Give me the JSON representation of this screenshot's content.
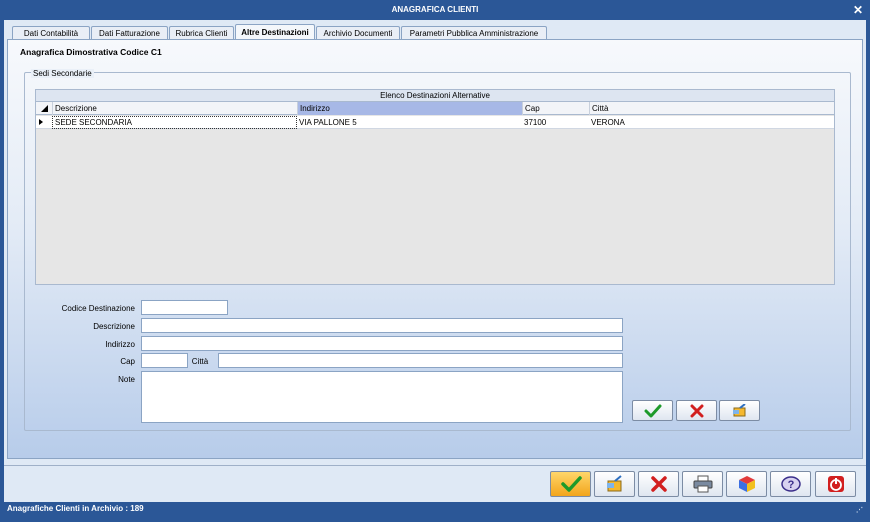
{
  "window": {
    "title": "ANAGRAFICA CLIENTI"
  },
  "tabs": [
    {
      "label": "Dati Contabilità"
    },
    {
      "label": "Dati Fatturazione"
    },
    {
      "label": "Rubrica Clienti"
    },
    {
      "label": "Altre Destinazioni"
    },
    {
      "label": "Archivio Documenti"
    },
    {
      "label": "Parametri Pubblica Amministrazione"
    }
  ],
  "active_tab": "Altre Destinazioni",
  "section": {
    "title": "Anagrafica Dimostrativa Codice C1"
  },
  "group": {
    "label": "Sedi Secondarie"
  },
  "grid": {
    "caption": "Elenco Destinazioni Alternative",
    "columns": [
      "Descrizione",
      "Indirizzo",
      "Cap",
      "Città"
    ],
    "rows": [
      [
        "SEDE SECONDARIA",
        "VIA PALLONE 5",
        "37100",
        "VERONA"
      ]
    ]
  },
  "form": {
    "codice_label": "Codice Destinazione",
    "codice_value": "",
    "descrizione_label": "Descrizione",
    "descrizione_value": "",
    "indirizzo_label": "Indirizzo",
    "indirizzo_value": "",
    "cap_label": "Cap",
    "cap_value": "",
    "citta_label": "Città",
    "citta_value": "",
    "note_label": "Note",
    "note_value": ""
  },
  "status": {
    "text": "Anagrafiche Clienti in Archivio :  189"
  },
  "icons": {
    "confirm": "check-icon",
    "cancel": "cross-icon",
    "clear": "broom-icon",
    "print": "printer-icon",
    "other": "cube-icon",
    "help": "help-icon",
    "exit": "power-icon"
  },
  "colors": {
    "titlebar": "#2b5797",
    "sorted_column": "#a7b8e6",
    "accent_yellow": "#f5b82e"
  }
}
